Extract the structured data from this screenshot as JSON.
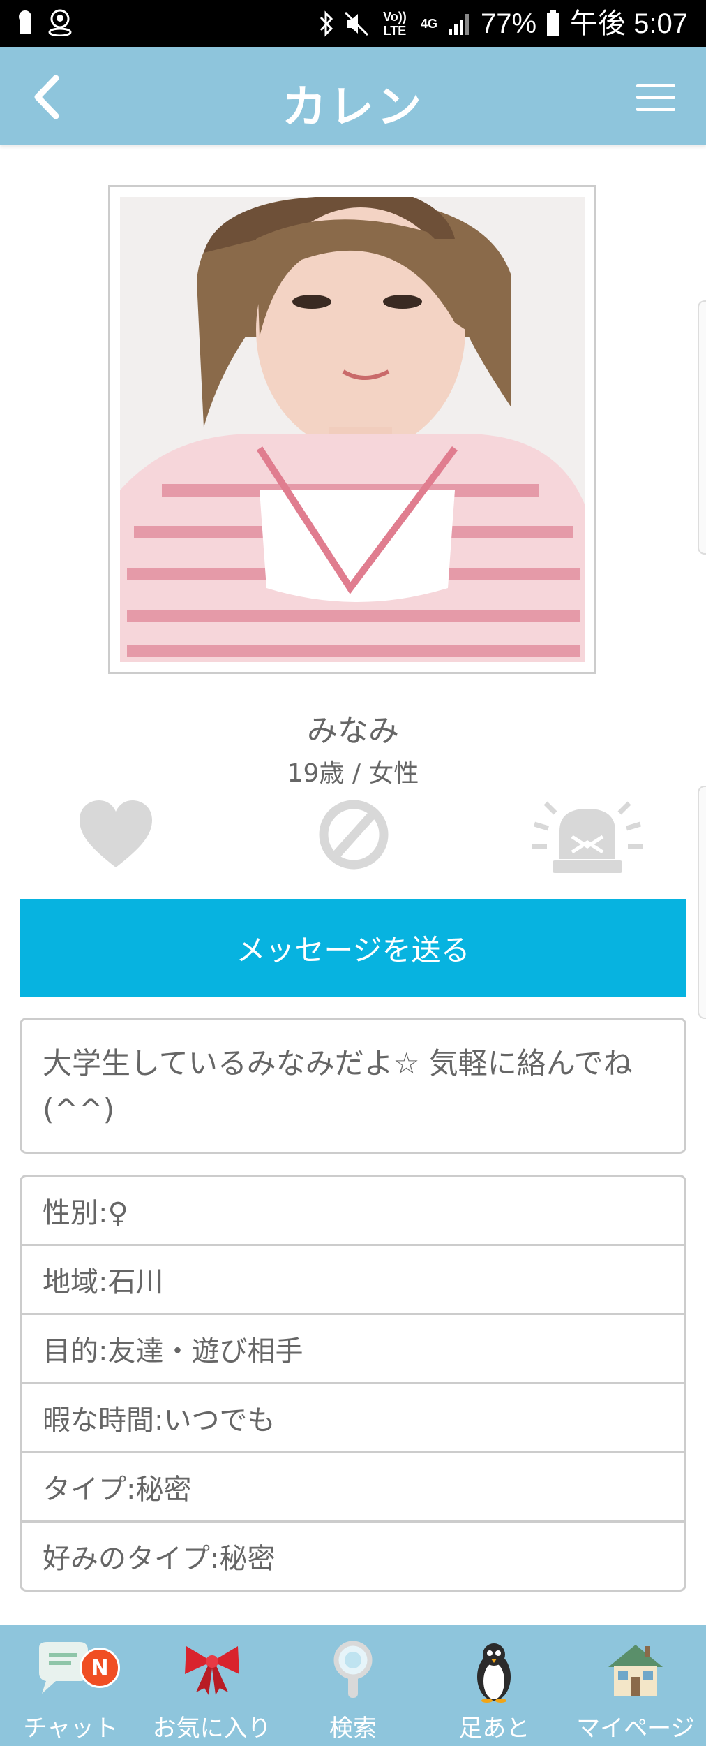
{
  "status_bar": {
    "volte": "Vo)) LTE",
    "network": "4G",
    "battery": "77%",
    "time": "午後 5:07"
  },
  "header": {
    "title": "カレン"
  },
  "profile": {
    "name": "みなみ",
    "age_gender": "19歳 / 女性",
    "message_button": "メッセージを送る",
    "bio": "大学生しているみなみだよ☆ 気軽に絡んでね(^^)",
    "details": [
      "性別:♀",
      "地域:石川",
      "目的:友達・遊び相手",
      "暇な時間:いつでも",
      "タイプ:秘密",
      "好みのタイプ:秘密"
    ]
  },
  "bottom_nav": {
    "items": [
      {
        "label": "チャット",
        "icon": "chat-icon",
        "badge": "N"
      },
      {
        "label": "お気に入り",
        "icon": "ribbon-icon"
      },
      {
        "label": "検索",
        "icon": "magnifier-icon"
      },
      {
        "label": "足あと",
        "icon": "penguin-icon"
      },
      {
        "label": "マイページ",
        "icon": "house-icon"
      }
    ]
  },
  "colors": {
    "header_bg": "#8ec5dc",
    "button_bg": "#07b3e0",
    "badge": "#f04e23"
  }
}
